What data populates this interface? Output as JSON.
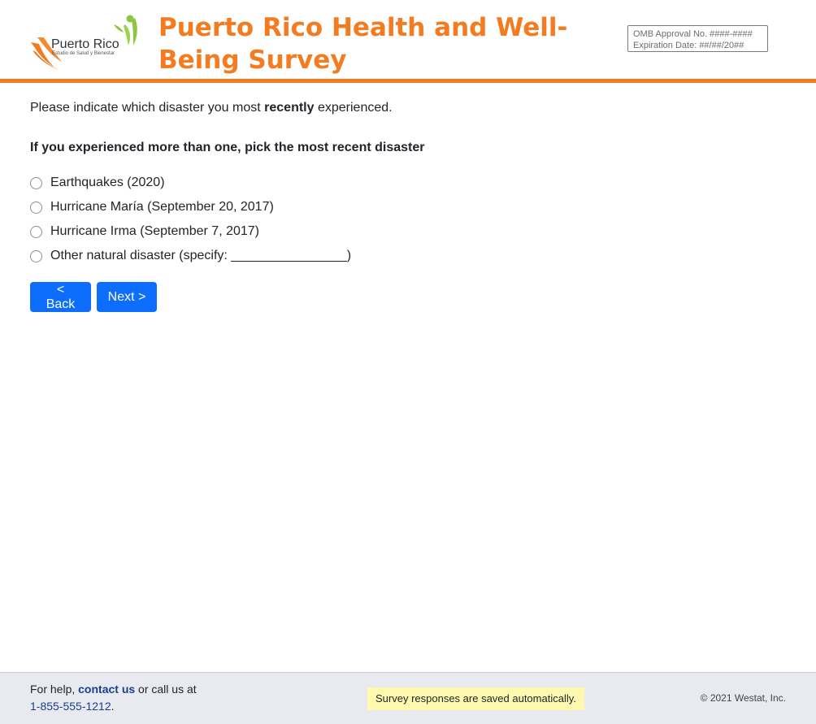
{
  "header": {
    "logo_text": "Puerto Rico",
    "logo_subtext": "Estudio de Salud y Bienestar",
    "title": "Puerto Rico Health and Well-Being Survey",
    "omb_approval": "OMB Approval No. ####-####",
    "expiration": "Expiration Date: ##/##/20##",
    "accent_color": "#f47b20"
  },
  "question": {
    "prefix": "Please indicate which disaster you most ",
    "emphasis": "recently",
    "suffix": " experienced.",
    "instruction": "If you experienced more than one, pick the most recent disaster",
    "options": [
      "Earthquakes (2020)",
      "Hurricane María (September 20, 2017)",
      "Hurricane Irma (September 7, 2017)",
      "Other natural disaster (specify: ________________)"
    ],
    "selected": null
  },
  "nav": {
    "back_label": "< Back",
    "next_label": "Next >",
    "button_color": "#0d6efd"
  },
  "footer": {
    "help_prefix": "For help, ",
    "contact_label": "contact us",
    "help_middle": " or call us at",
    "phone": "1-855-555-1212",
    "phone_suffix": ".",
    "saved_notice": "Survey responses are saved automatically.",
    "copyright": "© 2021 Westat, Inc."
  }
}
